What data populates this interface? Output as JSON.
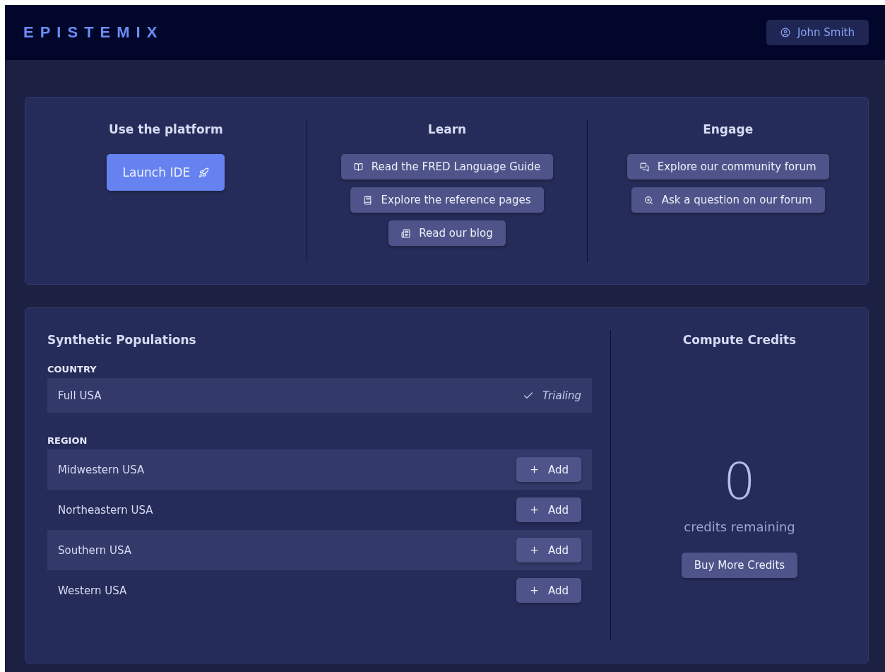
{
  "header": {
    "logo": "EPISTEMIX",
    "user": "John Smith"
  },
  "sections": [
    {
      "title": "Use the platform",
      "buttons": [
        {
          "label": "Launch IDE",
          "kind": "primary"
        }
      ]
    },
    {
      "title": "Learn",
      "buttons": [
        {
          "label": "Read the FRED Language Guide",
          "kind": "secondary"
        },
        {
          "label": "Explore the reference pages",
          "kind": "secondary"
        },
        {
          "label": "Read our blog",
          "kind": "secondary"
        }
      ]
    },
    {
      "title": "Engage",
      "buttons": [
        {
          "label": "Explore our community forum",
          "kind": "secondary"
        },
        {
          "label": "Ask a question on our forum",
          "kind": "secondary"
        }
      ]
    }
  ],
  "populations": {
    "title": "Synthetic Populations",
    "groups": [
      {
        "label": "COUNTRY",
        "items": [
          {
            "name": "Full USA",
            "kind": "status",
            "status": "Trialing"
          }
        ]
      },
      {
        "label": "REGION",
        "items": [
          {
            "name": "Midwestern USA",
            "kind": "add",
            "action": "Add"
          },
          {
            "name": "Northeastern USA",
            "kind": "add",
            "action": "Add"
          },
          {
            "name": "Southern USA",
            "kind": "add",
            "action": "Add"
          },
          {
            "name": "Western USA",
            "kind": "add",
            "action": "Add"
          }
        ]
      }
    ]
  },
  "credits": {
    "title": "Compute Credits",
    "count": "0",
    "caption": "credits remaining",
    "button": "Buy More Credits"
  }
}
